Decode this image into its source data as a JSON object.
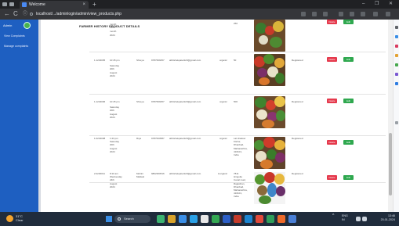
{
  "browser": {
    "tab_title": "Welcome",
    "tab_close": "×",
    "new_tab": "+",
    "minimize": "–",
    "restore": "❐",
    "close": "✕",
    "back": "←",
    "reload": "C",
    "info": "ⓘ",
    "url": "localhost/.../adminlogin/admin/view_products.php"
  },
  "sidebar": {
    "brand": "Admin",
    "links": [
      "View Complaints",
      "Manage complaints"
    ]
  },
  "page": {
    "title": "FARMER HISTORY PRODUCT DETAILS"
  },
  "rows": [
    {
      "id": "",
      "date_lines": [
        "",
        "",
        "month",
        "2024"
      ],
      "name": "",
      "phone": "",
      "email": "",
      "type": "",
      "qty": "250",
      "status": "",
      "delete": "Delete",
      "edit": "Edit"
    },
    {
      "id": "1.1234005",
      "date_lines": [
        "10:45 pm",
        "Saturday",
        "20th",
        "August",
        "2024"
      ],
      "name": "Shreya",
      "phone": "9787609457",
      "email": "abhishekpatel123@gmail.com",
      "type": "organic",
      "qty": "50",
      "status": "Registered",
      "delete": "Delete",
      "edit": "Edit"
    },
    {
      "id": "1.1234006",
      "date_lines": [
        "10:45 pm",
        "Saturday",
        "20th",
        "August",
        "2024"
      ],
      "name": "Shreya",
      "phone": "9787609457",
      "email": "abhishekpatel123@gmail.com",
      "type": "organic",
      "qty": "500",
      "status": "Registered",
      "delete": "Delete",
      "edit": "Edit"
    },
    {
      "id": "1.0234008",
      "date_lines": [
        "1:23 pm",
        "Saturday",
        "20th",
        "August",
        "2024"
      ],
      "name": "Riya",
      "phone": "9787620587",
      "email": "abhishekpatel123@gmail.com",
      "type": "organic",
      "qty_lines": [
        "Lal shadow",
        "Kishor,",
        "Dhanbad,",
        "Maharashtra,",
        "410101,",
        "India"
      ],
      "status": "Registered",
      "delete": "Delete",
      "edit": "Edit"
    },
    {
      "id": "2.0230011",
      "date_lines": [
        "8:10 am",
        "Wednesday",
        "24th",
        "August",
        "2024"
      ],
      "name": "Mohini",
      "name2": "Maliwal",
      "phone": "9802360516",
      "email": "abhishekpatel123@gmail.com",
      "type": "inorganic",
      "qty_lines": [
        "7811",
        "Hingolia",
        "Canal road,",
        "Rajasthan,",
        "Dhanbad,",
        "Maharashtra,",
        "410101,",
        "India"
      ],
      "status": "Registered",
      "delete": "Delete",
      "edit": "Edit"
    }
  ],
  "taskbar": {
    "weather_temp": "31°C",
    "weather_desc": "Clear",
    "search_label": "Search",
    "lang": "ENG",
    "lang2": "IN",
    "time": "13:46",
    "date": "20-01-2024"
  },
  "colors": {
    "sidebar": "#1e5fc1",
    "delete": "#e5394c",
    "edit": "#2fa84f",
    "taskbar": "#202c3c"
  }
}
